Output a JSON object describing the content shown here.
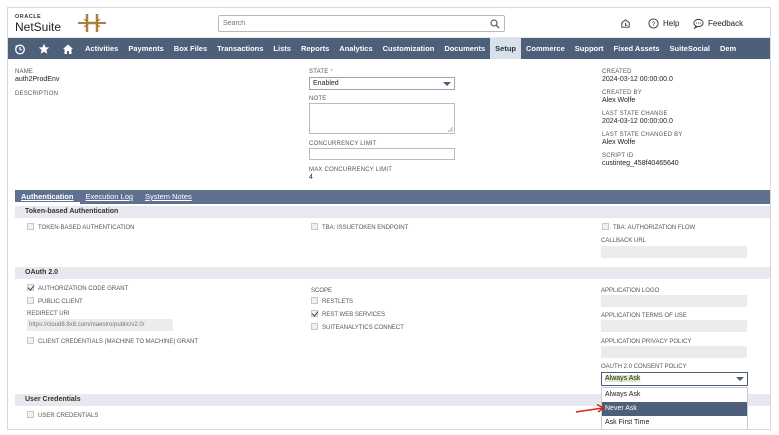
{
  "header": {
    "oracle": "ORACLE",
    "netsuite": "NetSuite",
    "search_placeholder": "Search",
    "help": "Help",
    "feedback": "Feedback"
  },
  "nav": {
    "items": [
      "Activities",
      "Payments",
      "Box Files",
      "Transactions",
      "Lists",
      "Reports",
      "Analytics",
      "Customization",
      "Documents",
      "Setup",
      "Commerce",
      "Support",
      "Fixed Assets",
      "SuiteSocial",
      "Dem"
    ],
    "active": "Setup"
  },
  "record": {
    "name_label": "NAME",
    "name_value": "auth2ProdEnv",
    "description_label": "DESCRIPTION",
    "state_label": "STATE",
    "state_required": "*",
    "state_value": "Enabled",
    "note_label": "NOTE",
    "concurrency_label": "CONCURRENCY LIMIT",
    "max_concurrency_label": "MAX CONCURRENCY LIMIT",
    "max_concurrency_value": "4",
    "created_label": "CREATED",
    "created_value": "2024-03-12 00:00:00.0",
    "created_by_label": "CREATED BY",
    "created_by_value": "Alex Wolfe",
    "last_state_change_label": "LAST STATE CHANGE",
    "last_state_change_value": "2024-03-12 00:00:00.0",
    "last_state_changed_by_label": "LAST STATE CHANGED BY",
    "last_state_changed_by_value": "Alex Wolfe",
    "script_id_label": "SCRIPT ID",
    "script_id_value": "custinteg_458f40465640"
  },
  "subtabs": {
    "authentication": "Authentication",
    "execution_log": "Execution Log",
    "system_notes": "System Notes"
  },
  "token": {
    "section": "Token-based Authentication",
    "tba": "TOKEN-BASED AUTHENTICATION",
    "issuetoken": "TBA: ISSUETOKEN ENDPOINT",
    "auth_flow": "TBA: AUTHORIZATION FLOW",
    "callback_url": "CALLBACK URL"
  },
  "oauth": {
    "section": "OAuth 2.0",
    "auth_code_grant": "AUTHORIZATION CODE GRANT",
    "public_client": "PUBLIC CLIENT",
    "redirect_uri_label": "REDIRECT URI",
    "redirect_uri_value": "https://cloud8.8x8.com/maestro/public/v2.0/",
    "client_credentials": "CLIENT CREDENTIALS (MACHINE TO MACHINE) GRANT",
    "scope_label": "SCOPE",
    "restlets": "RESTLETS",
    "rest_web_services": "REST WEB SERVICES",
    "suiteanalytics": "SUITEANALYTICS CONNECT",
    "app_logo": "APPLICATION LOGO",
    "app_terms": "APPLICATION TERMS OF USE",
    "app_privacy": "APPLICATION PRIVACY POLICY",
    "consent_label": "OAUTH 2.0 CONSENT POLICY",
    "consent_value": "Always Ask",
    "consent_options": [
      "Always Ask",
      "Never Ask",
      "Ask First Time"
    ]
  },
  "user_creds": {
    "section": "User Credentials",
    "user_credentials": "USER CREDENTIALS"
  },
  "colors": {
    "nav_bg": "#4d5f79",
    "accent_orange": "#e88a00",
    "annotation_arrow": "#e02020"
  }
}
